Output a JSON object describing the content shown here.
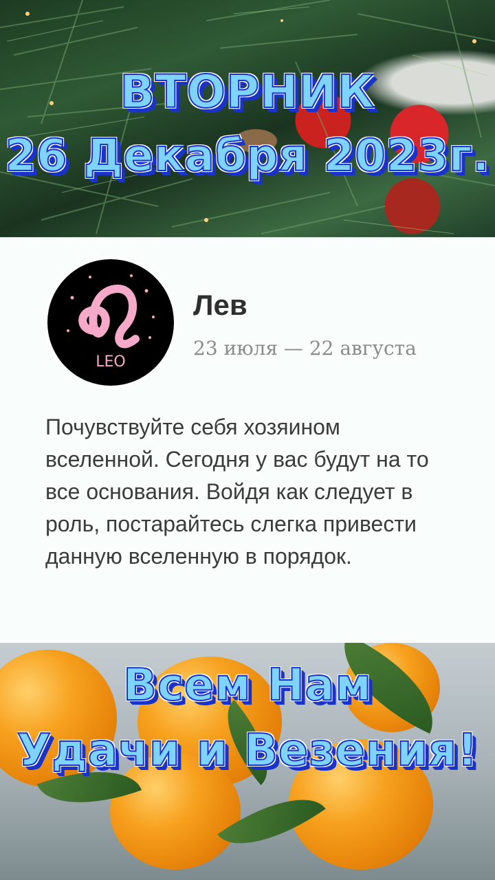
{
  "header": {
    "weekday": "ВТОРНИК",
    "date": "26 Декабря 2023г."
  },
  "horoscope": {
    "sign": "Лев",
    "emblem_text": "LEO",
    "date_range": "23 июля — 22 августа",
    "text": "Почувствуйте себя хозяином вселенной. Сегодня у вас будут на то все основания. Войдя как следует в роль, постарайтесь слегка привести данную вселенную в порядок."
  },
  "footer": {
    "wish_line1": "Всем Нам",
    "wish_line2": "Удачи и Везения!"
  },
  "colors": {
    "title_fill": "#7fd4ff",
    "title_outline": "#1a33c9",
    "card_bg": "#f9fdfb",
    "emblem_bg": "#000000",
    "emblem_glyph": "#f6a9c8"
  },
  "icons": {
    "emblem": "leo-zodiac-icon"
  }
}
